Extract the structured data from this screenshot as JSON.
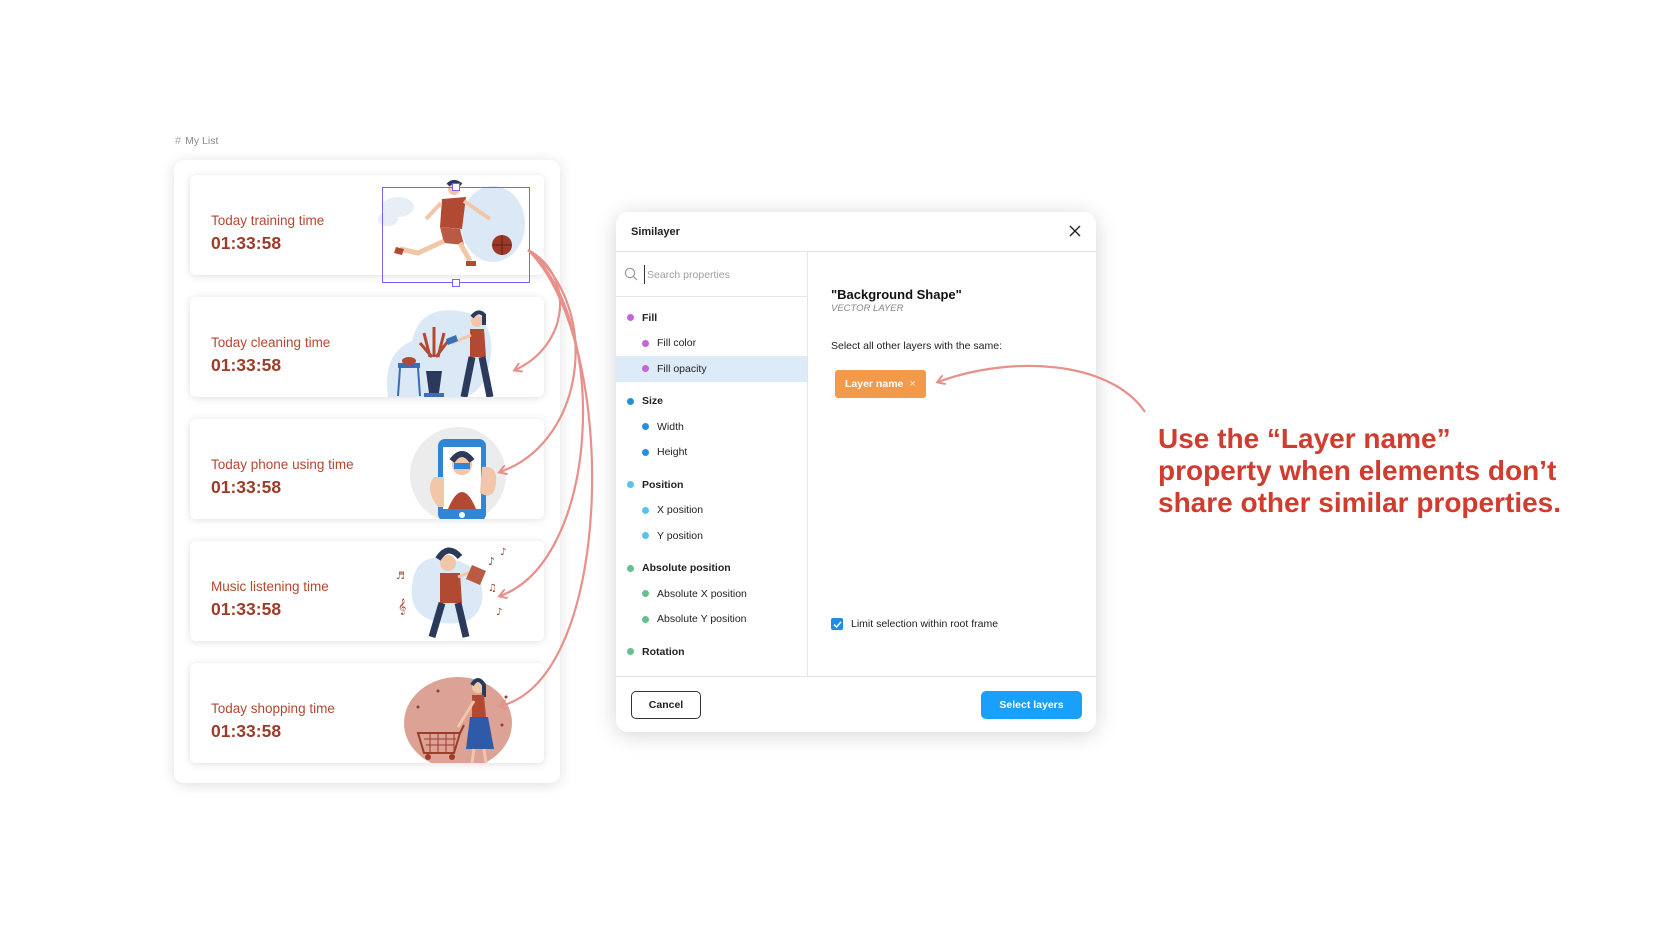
{
  "frame": {
    "label": "My List"
  },
  "cards": [
    {
      "title": "Today training time",
      "time": "01:33:58"
    },
    {
      "title": "Today cleaning time",
      "time": "01:33:58"
    },
    {
      "title": "Today phone using time",
      "time": "01:33:58"
    },
    {
      "title": "Music listening time",
      "time": "01:33:58"
    },
    {
      "title": "Today shopping time",
      "time": "01:33:58"
    }
  ],
  "dialog": {
    "title": "Similayer",
    "search_placeholder": "Search properties",
    "properties": [
      {
        "label": "Fill",
        "kind": "group",
        "color": "#c565d7"
      },
      {
        "label": "Fill color",
        "kind": "item",
        "color": "#c565d7"
      },
      {
        "label": "Fill opacity",
        "kind": "item",
        "color": "#c565d7",
        "active": true
      },
      {
        "label": "Size",
        "kind": "group",
        "color": "#2590d9"
      },
      {
        "label": "Width",
        "kind": "item",
        "color": "#2590d9"
      },
      {
        "label": "Height",
        "kind": "item",
        "color": "#2590d9"
      },
      {
        "label": "Position",
        "kind": "group",
        "color": "#5bc2eb"
      },
      {
        "label": "X position",
        "kind": "item",
        "color": "#5bc2eb"
      },
      {
        "label": "Y position",
        "kind": "item",
        "color": "#5bc2eb"
      },
      {
        "label": "Absolute position",
        "kind": "group",
        "color": "#62c18c"
      },
      {
        "label": "Absolute X position",
        "kind": "item",
        "color": "#62c18c"
      },
      {
        "label": "Absolute Y position",
        "kind": "item",
        "color": "#62c18c"
      },
      {
        "label": "Rotation",
        "kind": "group",
        "color": "#62c18c"
      }
    ],
    "layer_name": "\"Background Shape\"",
    "layer_type": "VECTOR LAYER",
    "same_label": "Select all other layers with the same:",
    "chip_label": "Layer name",
    "chip_remove": "×",
    "limit_label": "Limit selection within root frame",
    "limit_checked": true,
    "cancel_label": "Cancel",
    "select_label": "Select layers"
  },
  "annotation": {
    "lines": [
      "Use the “Layer name”",
      "property when elements don’t",
      "share other similar properties."
    ],
    "color": "#d03c2e"
  },
  "colors": {
    "card_title": "#b6472f",
    "card_time": "#9c3d2a",
    "selection": "#7b61ff",
    "chip": "#f2994a",
    "primary_button": "#18a0fb",
    "arrow": "#e8908a"
  }
}
